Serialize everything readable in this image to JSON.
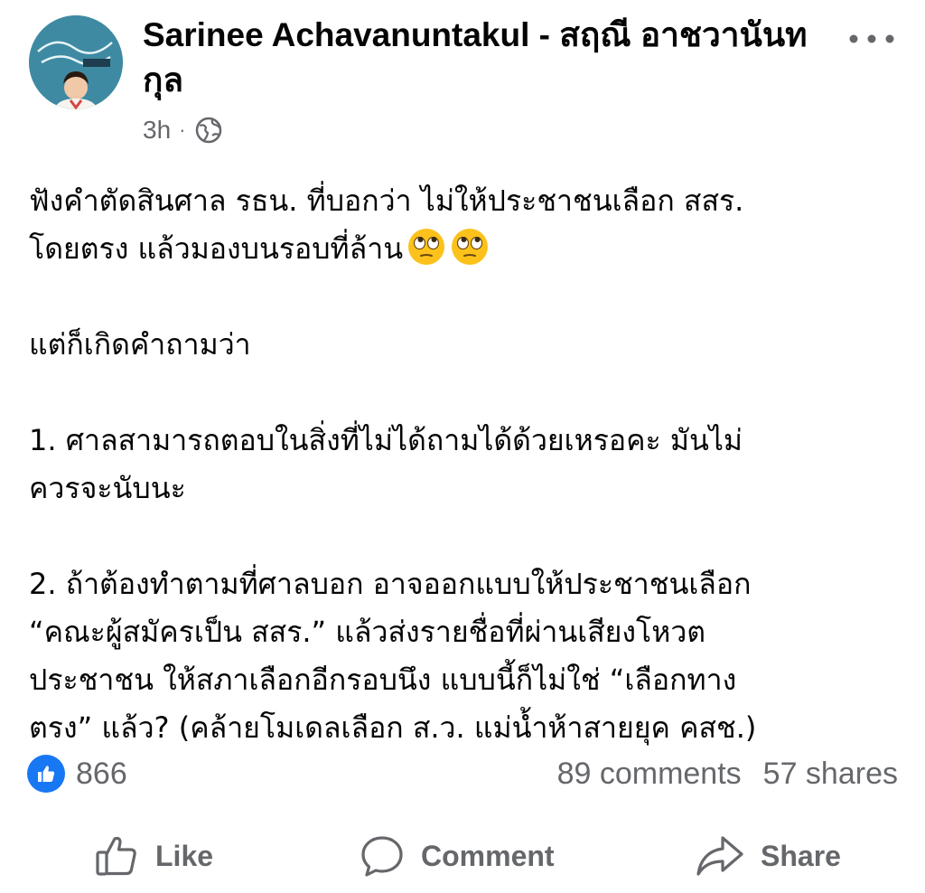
{
  "post": {
    "author": "Sarinee Achavanuntakul - สฤณี อาชวานันทกุล",
    "time": "3h",
    "meta_separator": "·",
    "audience_icon": "globe-icon",
    "paragraphs": [
      "ฟังคำตัดสินศาล รธน. ที่บอกว่า ไม่ให้ประชาชนเลือก สสร.\nโดยตรง แล้วมองบนรอบที่ล้าน",
      "แต่ก็เกิดคำถามว่า",
      "1. ศาลสามารถตอบในสิ่งที่ไม่ได้ถามได้ด้วยเหรอคะ มันไม่\nควรจะนับนะ",
      "2. ถ้าต้องทำตามที่ศาลบอก อาจออกแบบให้ประชาชนเลือก\n“คณะผู้สมัครเป็น สสร.” แล้วส่งรายชื่อที่ผ่านเสียงโหวต\nประชาชน ให้สภาเลือกอีกรอบนึง แบบนี้ก็ไม่ใช่ “เลือกทาง\nตรง” แล้ว? (คล้ายโมเดลเลือก ส.ว. แม่น้ำห้าสายยุค คสช.)"
    ],
    "emojis": [
      "face-with-rolling-eyes-emoji",
      "face-with-rolling-eyes-emoji"
    ]
  },
  "stats": {
    "reaction_icon": "like-reaction-icon",
    "reaction_count": "866",
    "comments": "89 comments",
    "shares": "57 shares"
  },
  "actions": {
    "like": "Like",
    "comment": "Comment",
    "share": "Share"
  },
  "colors": {
    "text": "#050505",
    "secondary": "#65676b",
    "like_blue": "#1877f2",
    "avatar_bg": "#3f8aa3"
  }
}
